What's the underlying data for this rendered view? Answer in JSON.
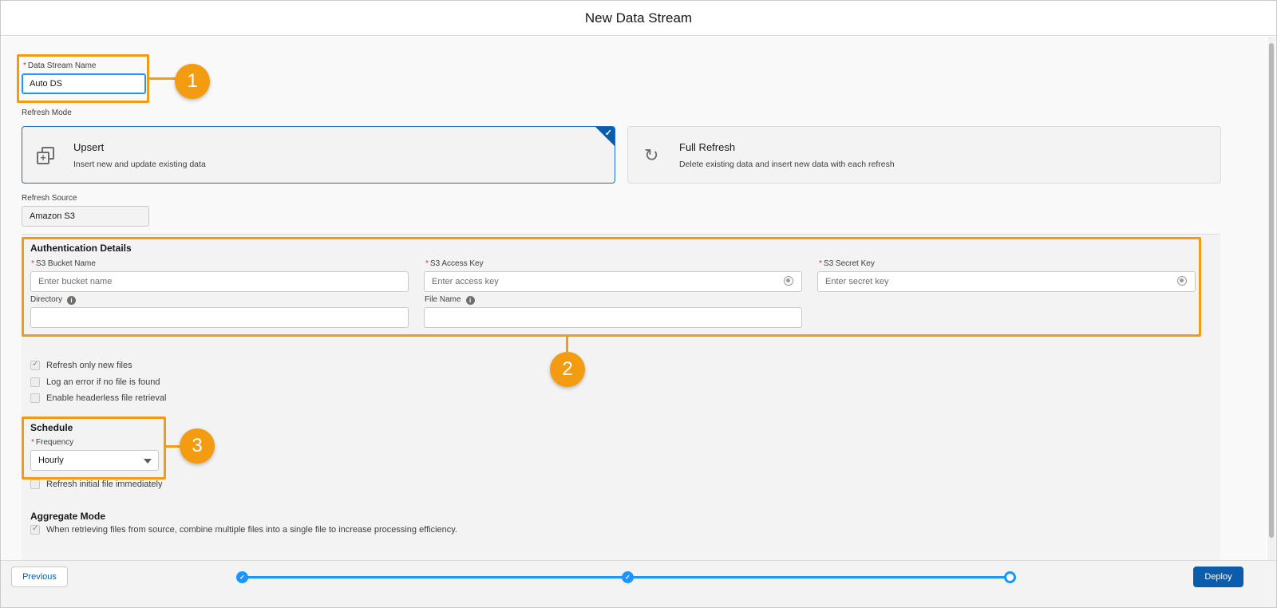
{
  "dialog": {
    "title": "New Data Stream"
  },
  "stream_name": {
    "label": "Data Stream Name",
    "value": "Auto DS"
  },
  "refresh_mode": {
    "label": "Refresh Mode",
    "options": [
      {
        "title": "Upsert",
        "description": "Insert new and update existing data",
        "selected": true
      },
      {
        "title": "Full Refresh",
        "description": "Delete existing data and insert new data with each refresh",
        "selected": false
      }
    ]
  },
  "refresh_source": {
    "label": "Refresh Source",
    "value": "Amazon S3"
  },
  "auth": {
    "title": "Authentication Details",
    "bucket": {
      "label": "S3 Bucket Name",
      "placeholder": "Enter bucket name"
    },
    "access_key": {
      "label": "S3 Access Key",
      "placeholder": "Enter access key"
    },
    "secret_key": {
      "label": "S3 Secret Key",
      "placeholder": "Enter secret key"
    },
    "directory": {
      "label": "Directory",
      "value": ""
    },
    "file_name": {
      "label": "File Name",
      "value": ""
    }
  },
  "options": {
    "refresh_new": {
      "label": "Refresh only new files",
      "checked": true
    },
    "log_error": {
      "label": "Log an error if no file is found",
      "checked": false
    },
    "headerless": {
      "label": "Enable headerless file retrieval",
      "checked": false
    }
  },
  "schedule": {
    "title": "Schedule",
    "frequency_label": "Frequency",
    "frequency_value": "Hourly",
    "refresh_initial": {
      "label": "Refresh initial file immediately",
      "checked": false
    }
  },
  "aggregate": {
    "title": "Aggregate Mode",
    "combine": {
      "label": "When retrieving files from source, combine multiple files into a single file to increase processing efficiency.",
      "checked": true
    }
  },
  "callouts": [
    "1",
    "2",
    "3"
  ],
  "footer": {
    "previous_label": "Previous",
    "deploy_label": "Deploy",
    "steps_total": 3,
    "steps_completed": 2
  },
  "colors": {
    "accent": "#0b5cab",
    "highlight": "#f39c12",
    "progress": "#1b96ff",
    "required": "#c23934"
  }
}
